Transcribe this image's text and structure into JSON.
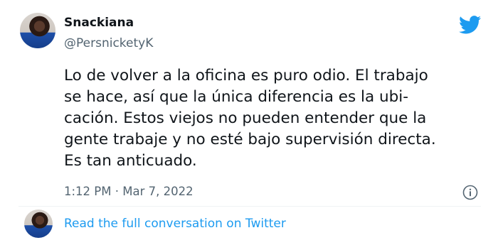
{
  "tweet": {
    "display_name": "Snackiana",
    "handle": "@PersnicketyK",
    "text_lines": [
      "Lo de volver a la oficina es puro odio. El trabajo",
      "se hace, así que la única diferencia es la ubi-",
      "cación. Estos viejos no pueden entender que la",
      "gente trabaje y no esté bajo supervisión directa.",
      "Es tan anticuado."
    ],
    "timestamp": "1:12 PM · Mar 7, 2022"
  },
  "footer": {
    "link_label": "Read the full conversation on Twitter"
  },
  "icons": {
    "brand": "twitter-bird-icon",
    "info": "info-icon"
  },
  "colors": {
    "brand_blue": "#1d9bf0",
    "secondary_text": "#536471",
    "primary_text": "#0f1419"
  }
}
